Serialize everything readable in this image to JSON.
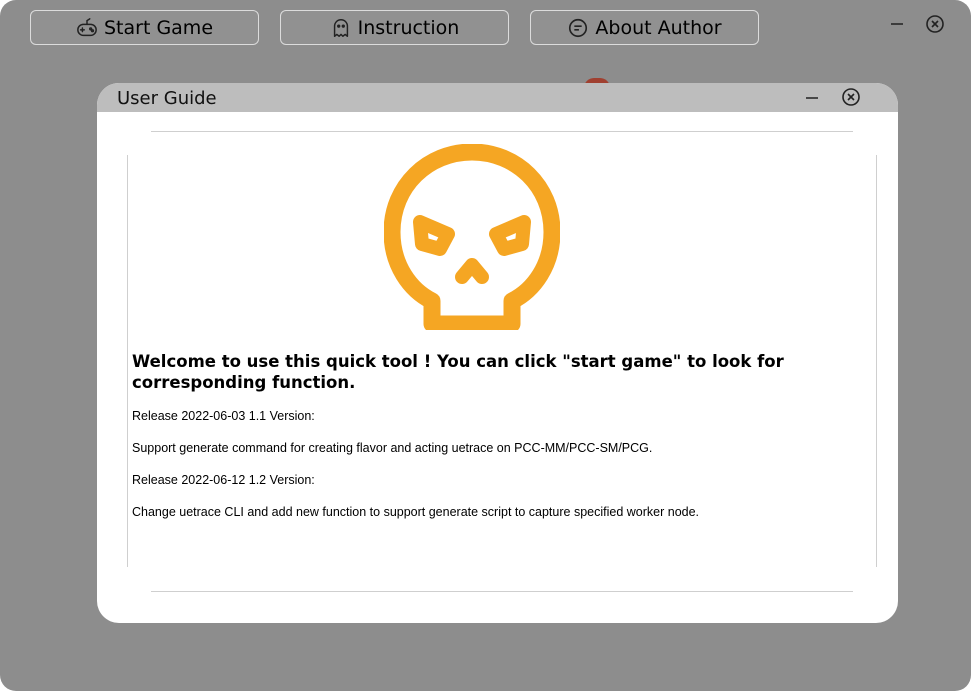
{
  "toolbar": {
    "start_game": "Start Game",
    "instruction": "Instruction",
    "about_author": "About Author"
  },
  "dialog": {
    "title": "User Guide",
    "welcome": "Welcome to use this quick tool ! You can click \"start game\" to look for corresponding function.",
    "release_1_title": "Release 2022-06-03 1.1 Version:",
    "release_1_text": "Support generate command for creating flavor and acting uetrace on PCC-MM/PCC-SM/PCG.",
    "release_2_title": "Release 2022-06-12 1.2 Version:",
    "release_2_text": "Change uetrace CLI and add new function to support generate script to capture specified worker node."
  },
  "icons": {
    "start_game": "gamepad-icon",
    "instruction": "ghost-icon",
    "about_author": "chat-bubble-icon",
    "logo": "skull-icon",
    "minimize": "minimize-icon",
    "close": "close-icon"
  },
  "colors": {
    "app_background": "#8d8d8d",
    "accent": "#f5a623",
    "title_bar": "#bdbdbd"
  }
}
